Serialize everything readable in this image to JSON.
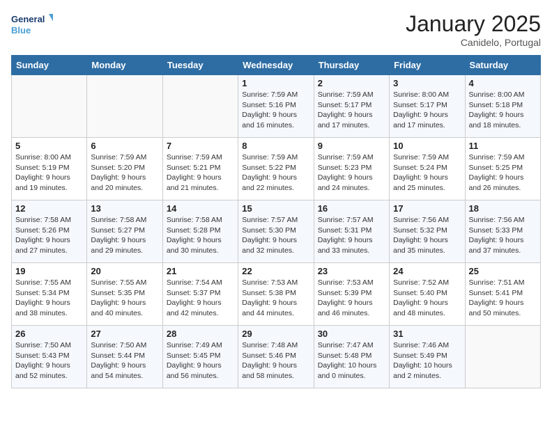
{
  "header": {
    "logo_line1": "General",
    "logo_line2": "Blue",
    "month": "January 2025",
    "location": "Canidelo, Portugal"
  },
  "weekdays": [
    "Sunday",
    "Monday",
    "Tuesday",
    "Wednesday",
    "Thursday",
    "Friday",
    "Saturday"
  ],
  "weeks": [
    [
      {
        "day": "",
        "info": ""
      },
      {
        "day": "",
        "info": ""
      },
      {
        "day": "",
        "info": ""
      },
      {
        "day": "1",
        "info": "Sunrise: 7:59 AM\nSunset: 5:16 PM\nDaylight: 9 hours\nand 16 minutes."
      },
      {
        "day": "2",
        "info": "Sunrise: 7:59 AM\nSunset: 5:17 PM\nDaylight: 9 hours\nand 17 minutes."
      },
      {
        "day": "3",
        "info": "Sunrise: 8:00 AM\nSunset: 5:17 PM\nDaylight: 9 hours\nand 17 minutes."
      },
      {
        "day": "4",
        "info": "Sunrise: 8:00 AM\nSunset: 5:18 PM\nDaylight: 9 hours\nand 18 minutes."
      }
    ],
    [
      {
        "day": "5",
        "info": "Sunrise: 8:00 AM\nSunset: 5:19 PM\nDaylight: 9 hours\nand 19 minutes."
      },
      {
        "day": "6",
        "info": "Sunrise: 7:59 AM\nSunset: 5:20 PM\nDaylight: 9 hours\nand 20 minutes."
      },
      {
        "day": "7",
        "info": "Sunrise: 7:59 AM\nSunset: 5:21 PM\nDaylight: 9 hours\nand 21 minutes."
      },
      {
        "day": "8",
        "info": "Sunrise: 7:59 AM\nSunset: 5:22 PM\nDaylight: 9 hours\nand 22 minutes."
      },
      {
        "day": "9",
        "info": "Sunrise: 7:59 AM\nSunset: 5:23 PM\nDaylight: 9 hours\nand 24 minutes."
      },
      {
        "day": "10",
        "info": "Sunrise: 7:59 AM\nSunset: 5:24 PM\nDaylight: 9 hours\nand 25 minutes."
      },
      {
        "day": "11",
        "info": "Sunrise: 7:59 AM\nSunset: 5:25 PM\nDaylight: 9 hours\nand 26 minutes."
      }
    ],
    [
      {
        "day": "12",
        "info": "Sunrise: 7:58 AM\nSunset: 5:26 PM\nDaylight: 9 hours\nand 27 minutes."
      },
      {
        "day": "13",
        "info": "Sunrise: 7:58 AM\nSunset: 5:27 PM\nDaylight: 9 hours\nand 29 minutes."
      },
      {
        "day": "14",
        "info": "Sunrise: 7:58 AM\nSunset: 5:28 PM\nDaylight: 9 hours\nand 30 minutes."
      },
      {
        "day": "15",
        "info": "Sunrise: 7:57 AM\nSunset: 5:30 PM\nDaylight: 9 hours\nand 32 minutes."
      },
      {
        "day": "16",
        "info": "Sunrise: 7:57 AM\nSunset: 5:31 PM\nDaylight: 9 hours\nand 33 minutes."
      },
      {
        "day": "17",
        "info": "Sunrise: 7:56 AM\nSunset: 5:32 PM\nDaylight: 9 hours\nand 35 minutes."
      },
      {
        "day": "18",
        "info": "Sunrise: 7:56 AM\nSunset: 5:33 PM\nDaylight: 9 hours\nand 37 minutes."
      }
    ],
    [
      {
        "day": "19",
        "info": "Sunrise: 7:55 AM\nSunset: 5:34 PM\nDaylight: 9 hours\nand 38 minutes."
      },
      {
        "day": "20",
        "info": "Sunrise: 7:55 AM\nSunset: 5:35 PM\nDaylight: 9 hours\nand 40 minutes."
      },
      {
        "day": "21",
        "info": "Sunrise: 7:54 AM\nSunset: 5:37 PM\nDaylight: 9 hours\nand 42 minutes."
      },
      {
        "day": "22",
        "info": "Sunrise: 7:53 AM\nSunset: 5:38 PM\nDaylight: 9 hours\nand 44 minutes."
      },
      {
        "day": "23",
        "info": "Sunrise: 7:53 AM\nSunset: 5:39 PM\nDaylight: 9 hours\nand 46 minutes."
      },
      {
        "day": "24",
        "info": "Sunrise: 7:52 AM\nSunset: 5:40 PM\nDaylight: 9 hours\nand 48 minutes."
      },
      {
        "day": "25",
        "info": "Sunrise: 7:51 AM\nSunset: 5:41 PM\nDaylight: 9 hours\nand 50 minutes."
      }
    ],
    [
      {
        "day": "26",
        "info": "Sunrise: 7:50 AM\nSunset: 5:43 PM\nDaylight: 9 hours\nand 52 minutes."
      },
      {
        "day": "27",
        "info": "Sunrise: 7:50 AM\nSunset: 5:44 PM\nDaylight: 9 hours\nand 54 minutes."
      },
      {
        "day": "28",
        "info": "Sunrise: 7:49 AM\nSunset: 5:45 PM\nDaylight: 9 hours\nand 56 minutes."
      },
      {
        "day": "29",
        "info": "Sunrise: 7:48 AM\nSunset: 5:46 PM\nDaylight: 9 hours\nand 58 minutes."
      },
      {
        "day": "30",
        "info": "Sunrise: 7:47 AM\nSunset: 5:48 PM\nDaylight: 10 hours\nand 0 minutes."
      },
      {
        "day": "31",
        "info": "Sunrise: 7:46 AM\nSunset: 5:49 PM\nDaylight: 10 hours\nand 2 minutes."
      },
      {
        "day": "",
        "info": ""
      }
    ]
  ]
}
